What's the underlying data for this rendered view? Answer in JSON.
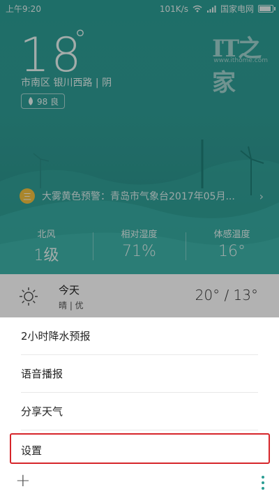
{
  "status_bar": {
    "time": "上午9:20",
    "speed": "101K/s",
    "carrier": "国家电网"
  },
  "weather": {
    "temperature": "18",
    "degree_symbol": "°",
    "location": "市南区  银川西路 | 阴",
    "aqi_label": "98 良"
  },
  "watermark": {
    "mark": "IT之家",
    "url": "www.ithome.com"
  },
  "alert": {
    "icon": "三",
    "text": "大雾黄色预警：青岛市气象台2017年05月...",
    "chevron": "›"
  },
  "metrics": [
    {
      "label": "北风",
      "value": "1级"
    },
    {
      "label": "相对湿度",
      "value": "71%"
    },
    {
      "label": "体感温度",
      "value": "16°"
    }
  ],
  "today": {
    "title": "今天",
    "subtitle": "晴 | 优",
    "range": "20° / 13°"
  },
  "menu": {
    "items": [
      {
        "label": "2小时降水预报"
      },
      {
        "label": "语音播报"
      },
      {
        "label": "分享天气"
      },
      {
        "label": "设置"
      }
    ]
  },
  "bottom": {
    "plus": "+"
  },
  "colors": {
    "accent": "#2a9d93",
    "highlight": "#d6252a"
  }
}
